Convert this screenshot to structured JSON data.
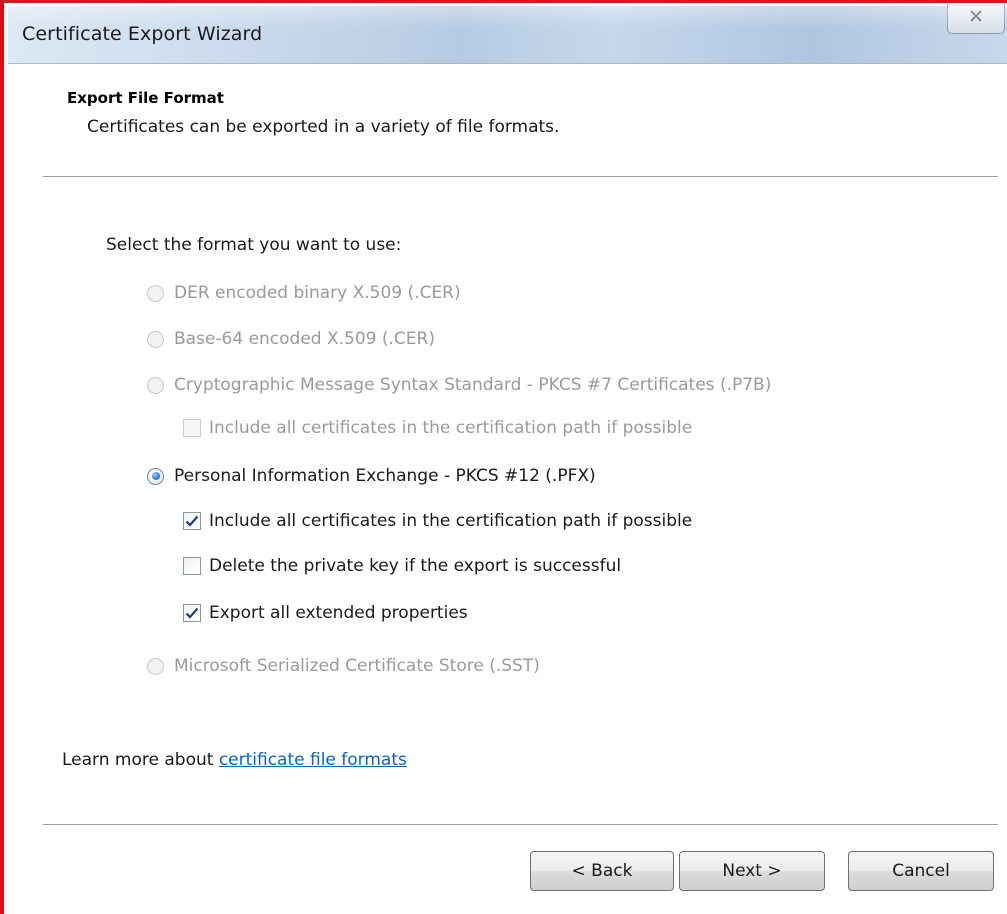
{
  "window": {
    "title": "Certificate Export Wizard",
    "close_glyph": "☒"
  },
  "header": {
    "title": "Export File Format",
    "subtitle": "Certificates can be exported in a variety of file formats."
  },
  "prompt": "Select the format you want to use:",
  "formats": {
    "der": {
      "label": "DER encoded binary X.509 (.CER)",
      "selected": false,
      "enabled": false
    },
    "base64": {
      "label": "Base-64 encoded X.509 (.CER)",
      "selected": false,
      "enabled": false
    },
    "pkcs7": {
      "label": "Cryptographic Message Syntax Standard - PKCS #7 Certificates (.P7B)",
      "selected": false,
      "enabled": false,
      "include_all": {
        "label": "Include all certificates in the certification path if possible",
        "checked": false,
        "enabled": false
      }
    },
    "pfx": {
      "label": "Personal Information Exchange - PKCS #12 (.PFX)",
      "selected": true,
      "enabled": true,
      "include_all": {
        "label": "Include all certificates in the certification path if possible",
        "checked": true
      },
      "delete_key": {
        "label": "Delete the private key if the export is successful",
        "checked": false
      },
      "export_props": {
        "label": "Export all extended properties",
        "checked": true
      }
    },
    "sst": {
      "label": "Microsoft Serialized Certificate Store (.SST)",
      "selected": false,
      "enabled": false
    }
  },
  "learn_more": {
    "text": "Learn more about ",
    "link": "certificate file formats"
  },
  "buttons": {
    "back": "< Back",
    "next": "Next >",
    "cancel": "Cancel"
  },
  "colors": {
    "frame_border": "#d40f16",
    "link": "#0a64c8",
    "disabled_text": "#9a9a9a"
  }
}
